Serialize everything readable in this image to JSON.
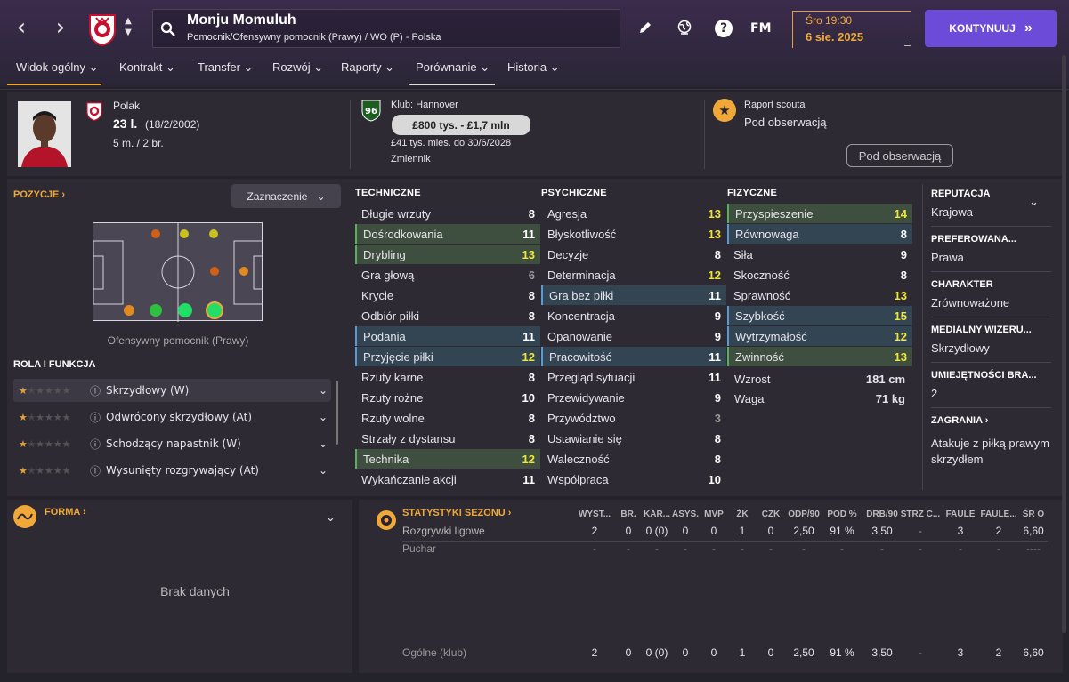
{
  "topbar": {
    "player_name": "Monju Momuluh",
    "player_positions": "Pomocnik/Ofensywny pomocnik (Prawy) / WO (P) - Polska",
    "fm_label": "FM",
    "time": "Śro 19:30",
    "date": "6 sie. 2025",
    "continue_label": "KONTYNUUJ"
  },
  "tabs": [
    {
      "label": "Widok ogólny"
    },
    {
      "label": "Kontrakt"
    },
    {
      "label": "Transfer"
    },
    {
      "label": "Rozwój"
    },
    {
      "label": "Raporty"
    },
    {
      "label": "Porównanie"
    },
    {
      "label": "Historia"
    }
  ],
  "info": {
    "nationality": "Polak",
    "age": "23 l.",
    "birth": "(18/2/2002)",
    "caps": "5 m. / 2 br.",
    "club": "Klub: Hannover",
    "value": "£800 tys. - £1,7 mln",
    "contract": "£41 tys. mies. do 30/6/2028",
    "squad_status": "Zmiennik",
    "scout_label": "Raport scouta",
    "scout_status": "Pod obserwacją",
    "watch_button": "Pod obserwacją"
  },
  "positions": {
    "title": "POZYCJE",
    "dropdown": "Zaznaczenie",
    "selected": "Ofensywny pomocnik (Prawy)"
  },
  "roles": {
    "title": "ROLA I FUNKCJA",
    "items": [
      {
        "label": "Skrzydłowy (W)"
      },
      {
        "label": "Odwrócony skrzydłowy (At)"
      },
      {
        "label": "Schodzący napastnik (W)"
      },
      {
        "label": "Wysunięty rozgrywający (At)"
      }
    ]
  },
  "technical": {
    "title": "TECHNICZNE",
    "rows": [
      {
        "name": "Długie wrzuty",
        "value": "8"
      },
      {
        "name": "Dośrodkowania",
        "value": "11"
      },
      {
        "name": "Drybling",
        "value": "13"
      },
      {
        "name": "Gra głową",
        "value": "6"
      },
      {
        "name": "Krycie",
        "value": "8"
      },
      {
        "name": "Odbiór piłki",
        "value": "8"
      },
      {
        "name": "Podania",
        "value": "11"
      },
      {
        "name": "Przyjęcie piłki",
        "value": "12"
      },
      {
        "name": "Rzuty karne",
        "value": "8"
      },
      {
        "name": "Rzuty rożne",
        "value": "10"
      },
      {
        "name": "Rzuty wolne",
        "value": "8"
      },
      {
        "name": "Strzały z dystansu",
        "value": "8"
      },
      {
        "name": "Technika",
        "value": "12"
      },
      {
        "name": "Wykańczanie akcji",
        "value": "11"
      }
    ]
  },
  "mental": {
    "title": "PSYCHICZNE",
    "rows": [
      {
        "name": "Agresja",
        "value": "13"
      },
      {
        "name": "Błyskotliwość",
        "value": "13"
      },
      {
        "name": "Decyzje",
        "value": "8"
      },
      {
        "name": "Determinacja",
        "value": "12"
      },
      {
        "name": "Gra bez piłki",
        "value": "11"
      },
      {
        "name": "Koncentracja",
        "value": "9"
      },
      {
        "name": "Opanowanie",
        "value": "9"
      },
      {
        "name": "Pracowitość",
        "value": "11"
      },
      {
        "name": "Przegląd sytuacji",
        "value": "11"
      },
      {
        "name": "Przewidywanie",
        "value": "9"
      },
      {
        "name": "Przywództwo",
        "value": "3"
      },
      {
        "name": "Ustawianie się",
        "value": "8"
      },
      {
        "name": "Waleczność",
        "value": "8"
      },
      {
        "name": "Współpraca",
        "value": "10"
      }
    ]
  },
  "physical": {
    "title": "FIZYCZNE",
    "rows": [
      {
        "name": "Przyspieszenie",
        "value": "14"
      },
      {
        "name": "Równowaga",
        "value": "8"
      },
      {
        "name": "Siła",
        "value": "9"
      },
      {
        "name": "Skoczność",
        "value": "8"
      },
      {
        "name": "Sprawność",
        "value": "13"
      },
      {
        "name": "Szybkość",
        "value": "15"
      },
      {
        "name": "Wytrzymałość",
        "value": "12"
      },
      {
        "name": "Zwinność",
        "value": "13"
      }
    ],
    "height_label": "Wzrost",
    "height": "181 cm",
    "weight_label": "Waga",
    "weight": "71 kg"
  },
  "side": {
    "reputation_h": "REPUTACJA",
    "reputation": "Krajowa",
    "foot_h": "PREFEROWANA...",
    "foot": "Prawa",
    "character_h": "CHARAKTER",
    "character": "Zrównoważone",
    "media_h": "MEDIALNY WIZERU...",
    "media": "Skrzydłowy",
    "skills_h": "UMIEJĘTNOŚCI BRA...",
    "skills": "2",
    "moves_h": "ZAGRANIA",
    "moves": "Atakuje z piłką prawym skrzydłem"
  },
  "form": {
    "title": "FORMA",
    "empty": "Brak danych"
  },
  "season": {
    "title": "STATYSTYKI SEZONU",
    "headers": [
      "WYST...",
      "BR.",
      "KAR...",
      "ASYS.",
      "MVP",
      "ŻK",
      "CZK",
      "ODP/90",
      "POD %",
      "DRB/90",
      "STRZ C...",
      "FAULE",
      "FAULE...",
      "ŚR O"
    ],
    "rows": [
      {
        "label": "Rozgrywki ligowe",
        "cells": [
          "2",
          "0",
          "0 (0)",
          "0",
          "0",
          "1",
          "0",
          "2,50",
          "91 %",
          "3,50",
          "-",
          "3",
          "2",
          "6,60"
        ]
      },
      {
        "label": "Puchar",
        "cells": [
          "-",
          "-",
          "-",
          "-",
          "-",
          "-",
          "-",
          "-",
          "-",
          "-",
          "-",
          "-",
          "-",
          "----"
        ]
      },
      {
        "label": "Ogólne (klub)",
        "cells": [
          "2",
          "0",
          "0 (0)",
          "0",
          "0",
          "1",
          "0",
          "2,50",
          "91 %",
          "3,50",
          "-",
          "3",
          "2",
          "6,60"
        ]
      }
    ]
  },
  "colors": {
    "accent": "#f0a838",
    "primary_button": "#6b4bd8"
  }
}
